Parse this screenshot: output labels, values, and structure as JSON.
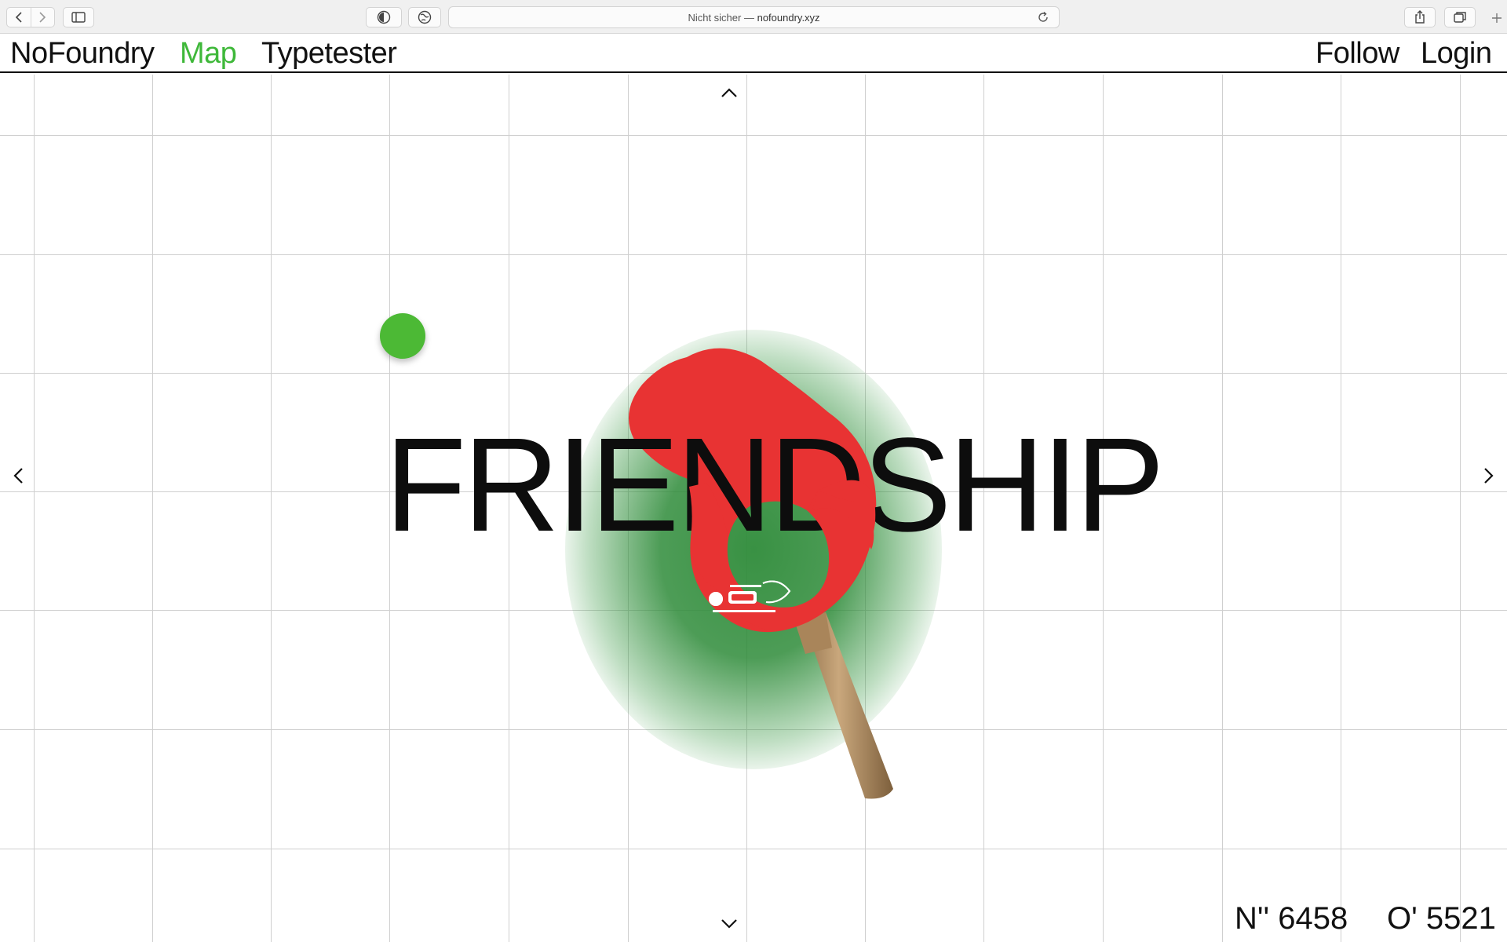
{
  "browser": {
    "address_prefix": "Nicht sicher —",
    "address_domain": "nofoundry.xyz"
  },
  "header": {
    "brand": "NoFoundry",
    "nav": [
      "Map",
      "Typetester"
    ],
    "follow": "Follow",
    "login": "Login"
  },
  "colors": {
    "accent_green": "#3fb83a",
    "paddle_red": "#e83333",
    "glow_green": "#2e8b39"
  },
  "map": {
    "headline": "FRIENDSHIP",
    "coord_n": "N'' 6458",
    "coord_o": "O' 5521",
    "arrows": [
      "chevron-up-icon",
      "chevron-down-icon",
      "chevron-left-icon",
      "chevron-right-icon"
    ]
  }
}
